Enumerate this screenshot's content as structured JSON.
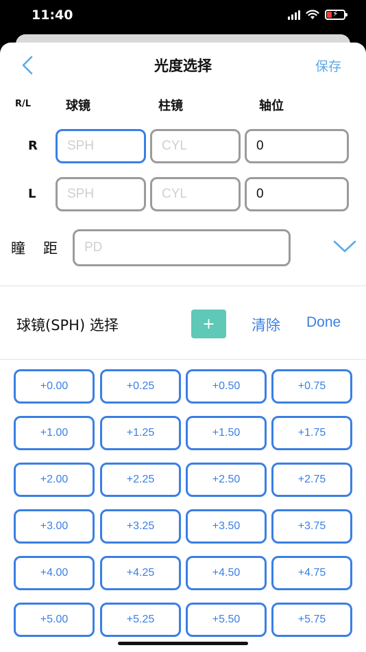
{
  "status": {
    "time": "11:40"
  },
  "nav": {
    "title": "光度选择",
    "save": "保存"
  },
  "headers": {
    "rl": "R/L",
    "sph": "球镜",
    "cyl": "柱镜",
    "axis": "轴位"
  },
  "rows": [
    {
      "label": "R",
      "sph_placeholder": "SPH",
      "cyl_placeholder": "CYL",
      "axis_value": "0"
    },
    {
      "label": "L",
      "sph_placeholder": "SPH",
      "cyl_placeholder": "CYL",
      "axis_value": "0"
    }
  ],
  "pd": {
    "label": "瞳距",
    "placeholder": "PD"
  },
  "selector": {
    "title": "球镜(SPH) 选择",
    "plus": "+",
    "clear": "清除",
    "done": "Done"
  },
  "values": [
    "+0.00",
    "+0.25",
    "+0.50",
    "+0.75",
    "+1.00",
    "+1.25",
    "+1.50",
    "+1.75",
    "+2.00",
    "+2.25",
    "+2.50",
    "+2.75",
    "+3.00",
    "+3.25",
    "+3.50",
    "+3.75",
    "+4.00",
    "+4.25",
    "+4.50",
    "+4.75",
    "+5.00",
    "+5.25",
    "+5.50",
    "+5.75"
  ],
  "colors": {
    "accent": "#3a7fe4",
    "save": "#5aa9e6",
    "plus_bg": "#5fc8b7",
    "border_gray": "#9b9b9b"
  }
}
